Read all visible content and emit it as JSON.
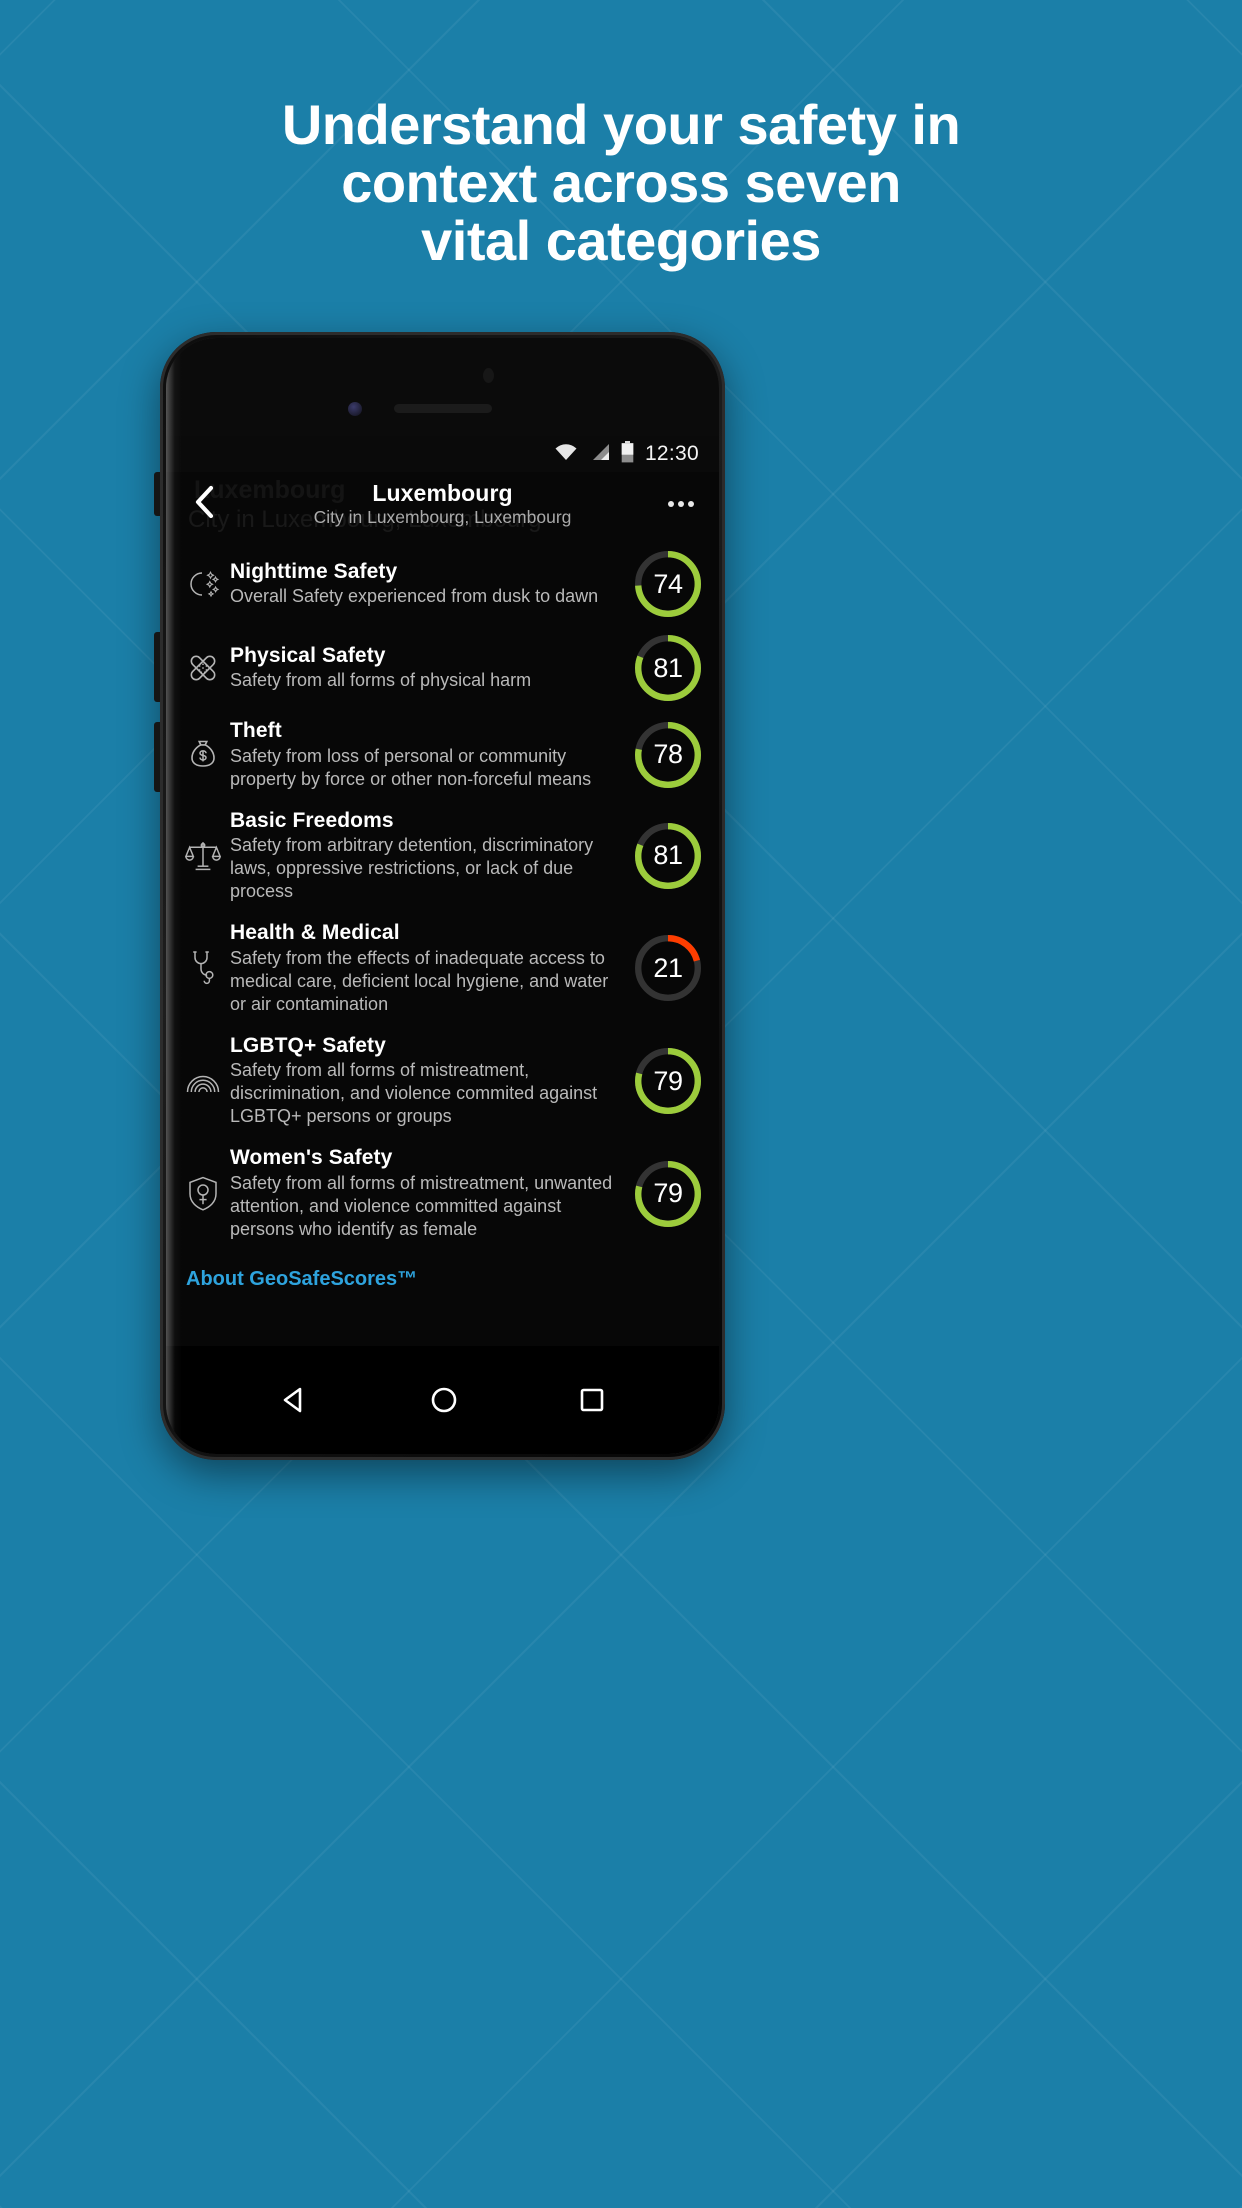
{
  "theme": {
    "background_blue": "#1b7fa8",
    "score_green": "#9ccc3c",
    "score_red": "#ff3d00",
    "track_gray": "#333333",
    "link_blue": "#2ea3dd"
  },
  "headline": {
    "line1": "Understand your safety in",
    "line2": "context across seven",
    "line3": "vital categories"
  },
  "phone": {
    "status_bar": {
      "time": "12:30",
      "wifi_icon": "wifi-icon",
      "signal_icon": "cellular-signal-icon",
      "battery_icon": "battery-icon"
    },
    "app_bar": {
      "back_icon": "chevron-left-icon",
      "title": "Luxembourg",
      "subtitle": "City in Luxembourg, Luxembourg",
      "overflow_icon": "overflow-menu-icon",
      "ghost_title": "Luxembourg",
      "ghost_subtitle": "City in Luxembourg, Luxembourg"
    },
    "categories": [
      {
        "icon": "moon-stars-icon",
        "title": "Nighttime Safety",
        "description": "Overall Safety experienced from dusk to dawn",
        "score": 74,
        "color": "#9ccc3c"
      },
      {
        "icon": "bandage-cross-icon",
        "title": "Physical Safety",
        "description": "Safety from all forms of physical harm",
        "score": 81,
        "color": "#9ccc3c"
      },
      {
        "icon": "money-bag-icon",
        "title": "Theft",
        "description": "Safety from loss of personal or community property by force or other non-forceful means",
        "score": 78,
        "color": "#9ccc3c"
      },
      {
        "icon": "scales-of-justice-icon",
        "title": "Basic Freedoms",
        "description": "Safety from arbitrary detention, discriminatory laws, oppressive restrictions, or lack of due process",
        "score": 81,
        "color": "#9ccc3c"
      },
      {
        "icon": "stethoscope-icon",
        "title": "Health & Medical",
        "description": "Safety from the effects of inadequate access to medical care, deficient local hygiene, and water or air contamination",
        "score": 21,
        "color": "#ff3d00"
      },
      {
        "icon": "rainbow-icon",
        "title": "LGBTQ+ Safety",
        "description": "Safety from all forms of mistreatment, discrimination, and violence commited against LGBTQ+ persons or groups",
        "score": 79,
        "color": "#9ccc3c"
      },
      {
        "icon": "women-shield-icon",
        "title": "Women's Safety",
        "description": "Safety from all forms of mistreatment, unwanted attention, and violence committed against persons who identify as female",
        "score": 79,
        "color": "#9ccc3c"
      }
    ],
    "about_link": "About GeoSafeScores™",
    "nav_bar": {
      "back": "android-back-triangle-icon",
      "home": "android-home-circle-icon",
      "recents": "android-recents-square-icon"
    }
  }
}
